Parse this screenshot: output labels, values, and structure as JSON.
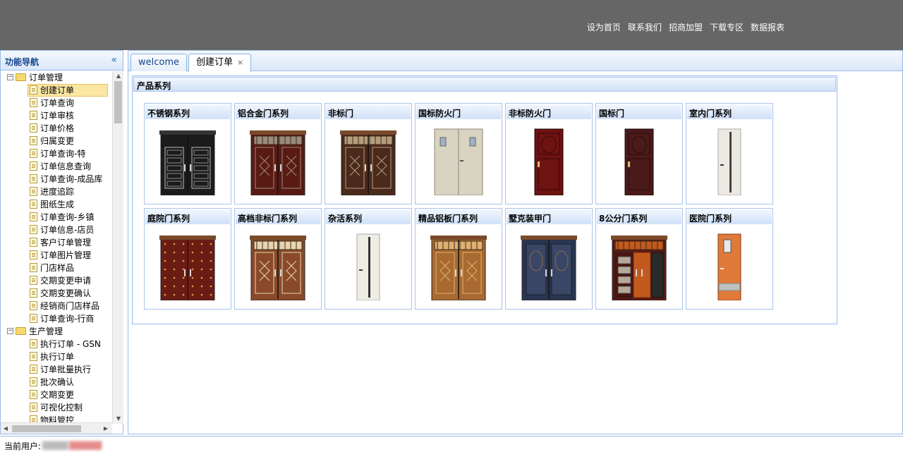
{
  "header": {
    "links": [
      "设为首页",
      "联系我们",
      "招商加盟",
      "下载专区",
      "数据报表"
    ]
  },
  "nav": {
    "title": "功能导航",
    "groups": [
      {
        "label": "订单管理",
        "items": [
          "创建订单",
          "订单查询",
          "订单审核",
          "订单价格",
          "归属变更",
          "订单查询-特",
          "订单信息查询",
          "订单查询-成品库",
          "进度追踪",
          "图纸生成",
          "订单查询-乡镇",
          "订单信息-店员",
          "客户订单管理",
          "订单图片管理",
          "门店样品",
          "交期变更申请",
          "交期变更确认",
          "经销商门店样品",
          "订单查询-行商"
        ]
      },
      {
        "label": "生产管理",
        "items": [
          "执行订单 - GSN",
          "执行订单",
          "订单批量执行",
          "批次确认",
          "交期变更",
          "可视化控制",
          "物料管控"
        ]
      }
    ],
    "selected": "创建订单"
  },
  "tabs": [
    {
      "label": "welcome",
      "active": false,
      "closable": false
    },
    {
      "label": "创建订单",
      "active": true,
      "closable": true
    }
  ],
  "tab_close_glyph": "×",
  "panel": {
    "title": "产品系列",
    "products": [
      {
        "name": "不锈钢系列",
        "door": {
          "type": "double",
          "color": "#1b1b1b",
          "accent": "#bfbfbf",
          "style": "black-steel"
        }
      },
      {
        "name": "铝合金门系列",
        "door": {
          "type": "double",
          "color": "#5a1a14",
          "accent": "#9a8a7a",
          "style": "lattice"
        }
      },
      {
        "name": "非标门",
        "door": {
          "type": "double",
          "color": "#4a2a1c",
          "accent": "#b59c7c",
          "style": "lattice"
        }
      },
      {
        "name": "国标防火门",
        "door": {
          "type": "fire",
          "color": "#d9d3c1",
          "accent": "#9fb0c2",
          "style": "fire"
        }
      },
      {
        "name": "非标防火门",
        "door": {
          "type": "single",
          "color": "#6e1212",
          "accent": "#3a0707",
          "style": "panel"
        }
      },
      {
        "name": "国标门",
        "door": {
          "type": "single",
          "color": "#4b1a1a",
          "accent": "#2a0b0b",
          "style": "panel"
        }
      },
      {
        "name": "室内门系列",
        "door": {
          "type": "interior",
          "color": "#ece9e1",
          "accent": "#444444",
          "style": "strip"
        }
      },
      {
        "name": "庭院门系列",
        "door": {
          "type": "double",
          "color": "#6a1c14",
          "accent": "#d9a640",
          "style": "studs"
        }
      },
      {
        "name": "高档非标门系列",
        "door": {
          "type": "double",
          "color": "#8a4a2a",
          "accent": "#e8d5b0",
          "style": "lattice"
        }
      },
      {
        "name": "杂活系列",
        "door": {
          "type": "interior",
          "color": "#efece4",
          "accent": "#333333",
          "style": "strip"
        }
      },
      {
        "name": "精品铝板门系列",
        "door": {
          "type": "double",
          "color": "#a86a30",
          "accent": "#e0b070",
          "style": "copper"
        }
      },
      {
        "name": "墅克装甲门",
        "door": {
          "type": "double",
          "color": "#2a3550",
          "accent": "#8a4a2a",
          "style": "armor"
        }
      },
      {
        "name": "8公分门系列",
        "door": {
          "type": "double",
          "color": "#5a1a14",
          "accent": "#c25a1e",
          "style": "eight"
        }
      },
      {
        "name": "医院门系列",
        "door": {
          "type": "hospital",
          "color": "#e07a3a",
          "accent": "#c0c0c0",
          "style": "hospital"
        }
      }
    ]
  },
  "status": {
    "label": "当前用户:"
  },
  "icons": {
    "collapse": "collapse-left-icon",
    "scroll_up": "▲",
    "scroll_down": "▼",
    "scroll_left": "◀",
    "scroll_right": "▶",
    "expander": "−",
    "collapse_glyph": "«"
  }
}
